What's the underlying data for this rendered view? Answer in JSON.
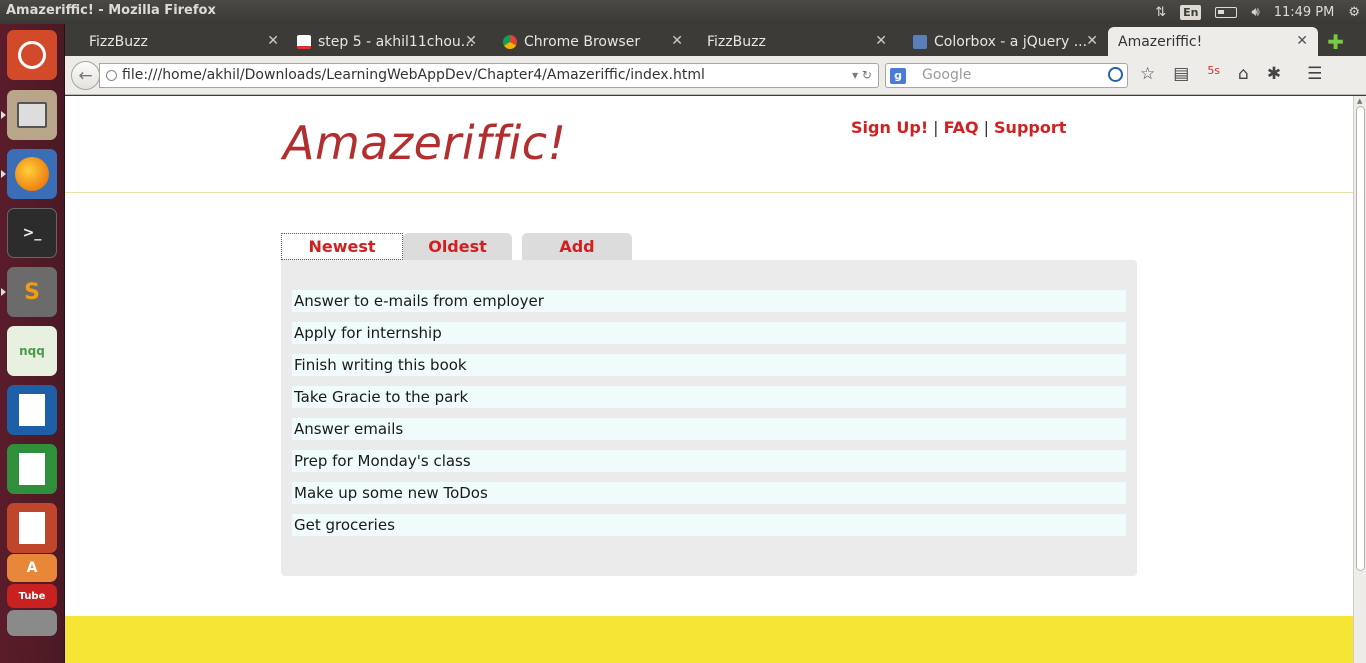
{
  "window": {
    "title": "Amazeriffic! - Mozilla Firefox"
  },
  "system": {
    "keyboard": "En",
    "clock": "11:49 PM"
  },
  "tabs": [
    {
      "label": "FizzBuzz"
    },
    {
      "label": "step 5 - akhil11chou..."
    },
    {
      "label": "Chrome Browser"
    },
    {
      "label": "FizzBuzz"
    },
    {
      "label": "Colorbox - a jQuery ..."
    },
    {
      "label": "Amazeriffic!"
    }
  ],
  "navbar": {
    "url": "file:///home/akhil/Downloads/LearningWebAppDev/Chapter4/Amazeriffic/index.html",
    "search_placeholder": "Google"
  },
  "page": {
    "logo": "Amazeriffic!",
    "links": {
      "signup": "Sign Up!",
      "faq": "FAQ",
      "support": "Support",
      "separator": "|"
    },
    "tabs": [
      "Newest",
      "Oldest",
      "Add"
    ],
    "todos": [
      "Answer to e-mails from employer",
      "Apply for internship",
      "Finish writing this book",
      "Take Gracie to the park",
      "Answer emails",
      "Prep for Monday's class",
      "Make up some new ToDos",
      "Get groceries"
    ]
  },
  "colors": {
    "accent_red": "#d21f1f",
    "logo_red": "#b32f2f",
    "footer_yellow": "#f7e536",
    "todo_bg": "#f0fbfb"
  }
}
